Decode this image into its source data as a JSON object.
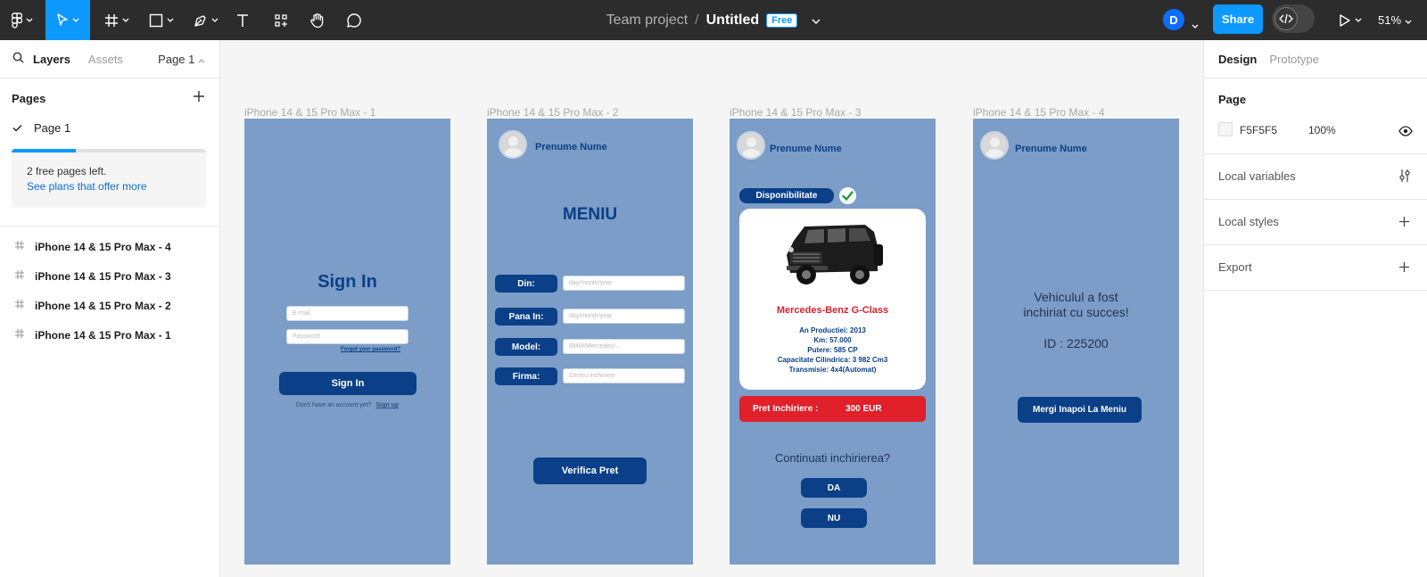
{
  "toolbar": {
    "project": "Team project",
    "separator": "/",
    "file_name": "Untitled",
    "plan_badge": "Free",
    "user_initial": "D",
    "share_label": "Share",
    "zoom": "51%"
  },
  "left_panel": {
    "tabs": [
      "Layers",
      "Assets"
    ],
    "page_selector": "Page 1",
    "pages_heading": "Pages",
    "pages": [
      {
        "name": "Page 1",
        "selected": true
      }
    ],
    "free_pages_text": "2 free pages left.",
    "plans_link": "See plans that offer more",
    "free_pages_used_fraction": 0.33,
    "layers": [
      "iPhone 14 & 15 Pro Max - 4",
      "iPhone 14 & 15 Pro Max - 3",
      "iPhone 14 & 15 Pro Max - 2",
      "iPhone 14 & 15 Pro Max - 1"
    ]
  },
  "frames": {
    "f1": {
      "label": "iPhone 14 & 15 Pro Max - 1",
      "title": "Sign In",
      "email_placeholder": "E-mail",
      "password_placeholder": "Password",
      "forgot": "Forgot your password?",
      "button": "Sign In",
      "no_account": "Don't have an account yet?",
      "signup": "Sign up"
    },
    "f2": {
      "label": "iPhone 14 & 15 Pro Max - 2",
      "user": "Prenume Nume",
      "title": "MENIU",
      "fields": [
        {
          "label": "Din:",
          "placeholder": "day/month/year"
        },
        {
          "label": "Pana In:",
          "placeholder": "day/month/year"
        },
        {
          "label": "Model:",
          "placeholder": "BMW/Mercedes/..."
        },
        {
          "label": "Firma:",
          "placeholder": "Centru Inchiriere"
        }
      ],
      "button": "Verifica Pret"
    },
    "f3": {
      "label": "iPhone 14 & 15 Pro Max - 3",
      "user": "Prenume Nume",
      "availability": "Disponibilitate",
      "car_name": "Mercedes-Benz G-Class",
      "specs": [
        "An Productiei: 2013",
        "Km: 57.000",
        "Putere: 585 CP",
        "Capacitate Cilindrica: 3 982 Cm3",
        "Transmisie: 4x4(Automat)"
      ],
      "price_label": "Pret Inchiriere :",
      "price_value": "300 EUR",
      "question": "Continuati inchirierea?",
      "yes": "DA",
      "no": "NU"
    },
    "f4": {
      "label": "iPhone 14 & 15 Pro Max - 4",
      "user": "Prenume Nume",
      "message_line1": "Vehiculul a fost",
      "message_line2": "inchiriat cu succes!",
      "id_text": "ID : 225200",
      "button": "Mergi Inapoi La Meniu"
    }
  },
  "right_panel": {
    "tabs": [
      "Design",
      "Prototype"
    ],
    "page_heading": "Page",
    "bg_color": "F5F5F5",
    "opacity": "100%",
    "local_variables": "Local variables",
    "local_styles": "Local styles",
    "export": "Export"
  },
  "colors": {
    "frame_bg": "#7b9dc7",
    "primary": "#0b3f88",
    "accent": "#0d99ff",
    "price_red": "#e0202a"
  }
}
